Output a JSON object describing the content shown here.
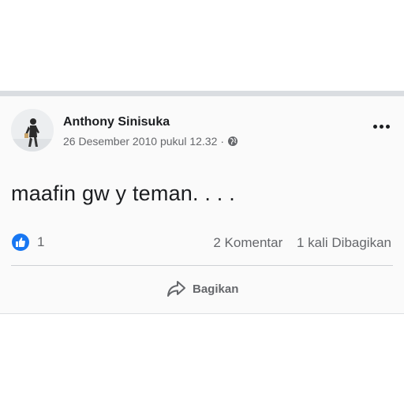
{
  "post": {
    "author": "Anthony Sinisuka",
    "timestamp": "26 Desember 2010 pukul 12.32",
    "separator": "·",
    "privacy_icon": "globe-icon",
    "text": "maafin gw y teman. . . .",
    "reactions": {
      "icon": "like-icon",
      "count": "1"
    },
    "comments_label": "2 Komentar",
    "shares_label": "1 kali Dibagikan",
    "share_button_label": "Bagikan"
  },
  "colors": {
    "like_blue": "#1877f2",
    "secondary_text": "#65676b",
    "primary_text": "#1c1e21"
  }
}
